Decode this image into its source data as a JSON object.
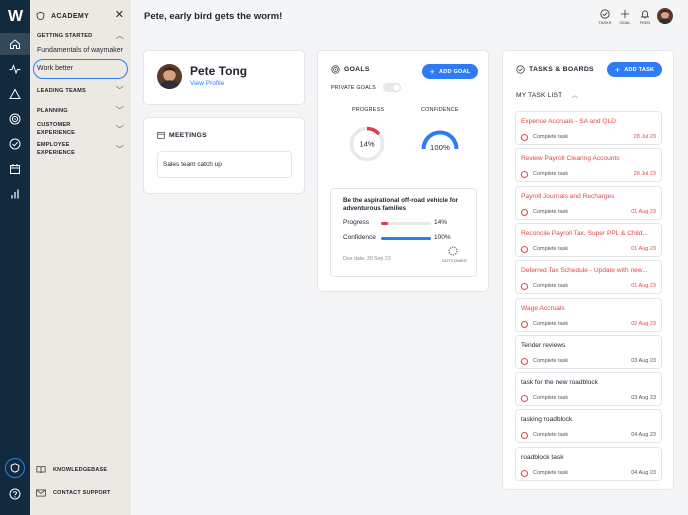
{
  "rail": {
    "logo": "W",
    "icons": [
      "home-icon",
      "activity-icon",
      "triangle-icon",
      "target-icon",
      "check-circle-icon",
      "calendar-icon",
      "bar-chart-icon",
      "shield-icon",
      "help-icon"
    ]
  },
  "academy": {
    "title": "ACADEMY",
    "close": "✕",
    "getting_started": "GETTING STARTED",
    "links": [
      "Fundamentals of waymaker",
      "Work better"
    ],
    "sections": [
      "LEADING TEAMS",
      "PLANNING",
      "CUSTOMER EXPERIENCE",
      "EMPLOYEE EXPERIENCE"
    ],
    "knowledgebase": "KNOWLEDGEBASE",
    "contact_support": "CONTACT SUPPORT"
  },
  "header": {
    "greeting": "Pete, early bird gets the worm!",
    "tasks_label": "TASKS",
    "goal_label": "GOAL",
    "feed_label": "FEED"
  },
  "profile": {
    "name": "Pete Tong",
    "view_profile": "View Profile"
  },
  "meetings": {
    "title": "MEETINGS",
    "item": "Sales team catch up"
  },
  "goals": {
    "title": "GOALS",
    "add_button": "ADD GOAL",
    "private_goals": "PRIVATE GOALS",
    "progress_label": "PROGRESS",
    "confidence_label": "CONFIDENCE",
    "progress_value": "14%",
    "confidence_value": "100%",
    "progress_fraction": 0.14,
    "confidence_fraction": 1.0,
    "goal": {
      "title": "Be the aspirational off-road vehicle for adventurous families",
      "progress_label": "Progress",
      "progress_value": "14%",
      "confidence_label": "Confidence",
      "confidence_value": "100%",
      "due_date": "Due date: 30 Sep 23",
      "outcomes_label": "OUTCOMES"
    },
    "colors": {
      "progress": "#e03a4e",
      "confidence": "#2d7cf6"
    }
  },
  "tasks": {
    "title": "TASKS & BOARDS",
    "add_button": "ADD TASK",
    "my_task_list": "MY TASK LIST",
    "items": [
      {
        "title": "Expense Accruals - SA and QLD",
        "status": "Complete task",
        "date": "28 Jul 23",
        "overdue": true
      },
      {
        "title": "Review Payroll Clearing Accounts",
        "status": "Complete task",
        "date": "28 Jul 23",
        "overdue": true
      },
      {
        "title": "Payroll Journals and Recharges",
        "status": "Complete task",
        "date": "01 Aug 23",
        "overdue": true
      },
      {
        "title": "Reconcile Payroll Tax, Super PPL & Child...",
        "status": "Complete task",
        "date": "01 Aug 23",
        "overdue": true
      },
      {
        "title": "Deferred Tax Schedule - Update with new...",
        "status": "Complete task",
        "date": "01 Aug 23",
        "overdue": true
      },
      {
        "title": "Wage Accruals",
        "status": "Complete task",
        "date": "02 Aug 23",
        "overdue": true
      },
      {
        "title": "Tender reviews",
        "status": "Complete task",
        "date": "03 Aug 23",
        "overdue": false
      },
      {
        "title": "task for the new roadblock",
        "status": "Complete task",
        "date": "03 Aug 23",
        "overdue": false
      },
      {
        "title": "tasking roadblock",
        "status": "Complete task",
        "date": "04 Aug 23",
        "overdue": false
      },
      {
        "title": "roadblock task",
        "status": "Complete task",
        "date": "04 Aug 23",
        "overdue": false
      }
    ]
  }
}
